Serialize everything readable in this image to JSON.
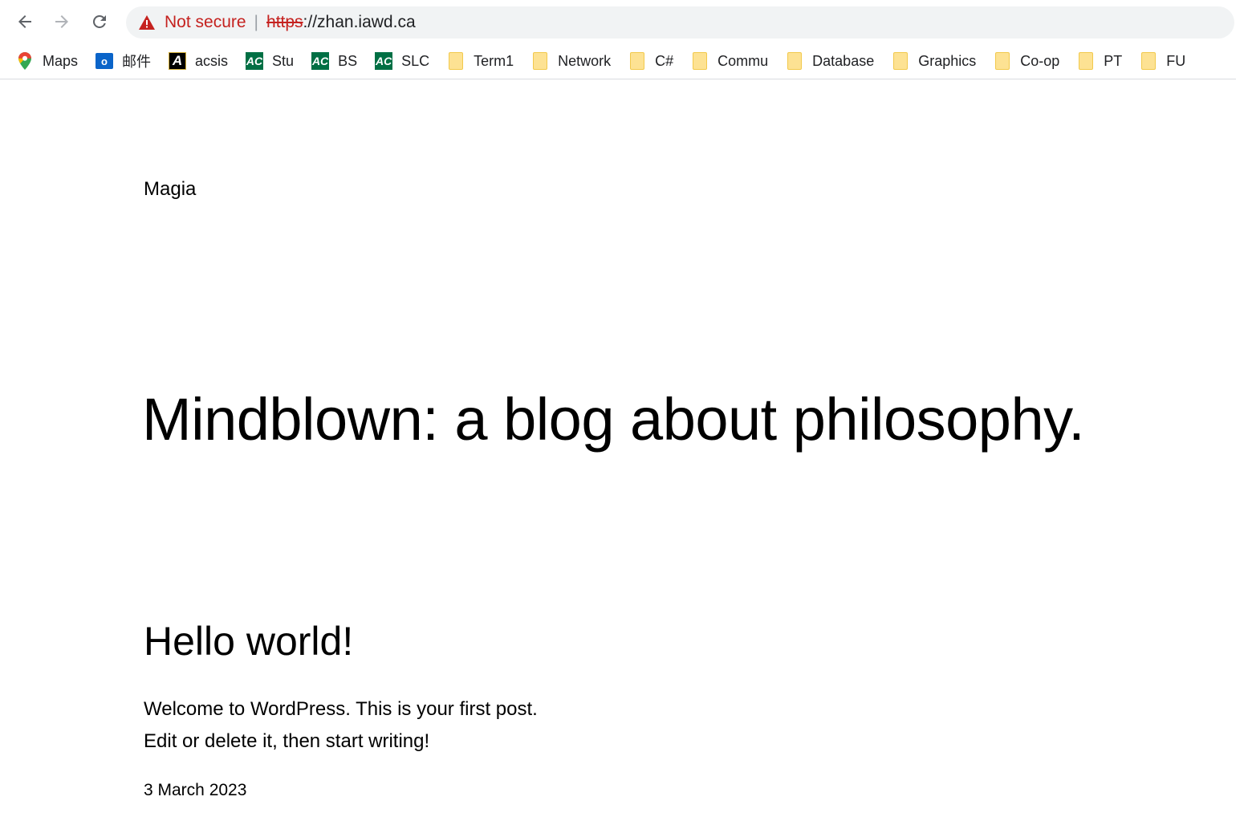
{
  "browser": {
    "security_label": "Not secure",
    "separator": "|",
    "url_scheme": "https",
    "url_rest": "://zhan.iawd.ca",
    "bookmarks": [
      {
        "label": "Maps",
        "icon": "maps-pin-icon"
      },
      {
        "label": "邮件",
        "icon": "outlook-icon"
      },
      {
        "label": "acsis",
        "icon": "acsis-icon"
      },
      {
        "label": "Stu",
        "icon": "algonquin-icon"
      },
      {
        "label": "BS",
        "icon": "algonquin-icon"
      },
      {
        "label": "SLC",
        "icon": "algonquin-icon"
      },
      {
        "label": "Term1",
        "icon": "folder-icon"
      },
      {
        "label": "Network",
        "icon": "folder-icon"
      },
      {
        "label": "C#",
        "icon": "folder-icon"
      },
      {
        "label": "Commu",
        "icon": "folder-icon"
      },
      {
        "label": "Database",
        "icon": "folder-icon"
      },
      {
        "label": "Graphics",
        "icon": "folder-icon"
      },
      {
        "label": "Co-op",
        "icon": "folder-icon"
      },
      {
        "label": "PT",
        "icon": "folder-icon"
      },
      {
        "label": "FU",
        "icon": "folder-icon"
      }
    ]
  },
  "site": {
    "title": "Magia",
    "tagline": "Mindblown: a blog about philosophy."
  },
  "post": {
    "title": "Hello world!",
    "line1": "Welcome to WordPress. This is your first post.",
    "line2": "Edit or delete it, then start writing!",
    "date": "3 March 2023"
  },
  "colors": {
    "warning_red": "#c5221f",
    "omnibox_bg": "#f1f3f4",
    "folder_yellow": "#fde293"
  }
}
